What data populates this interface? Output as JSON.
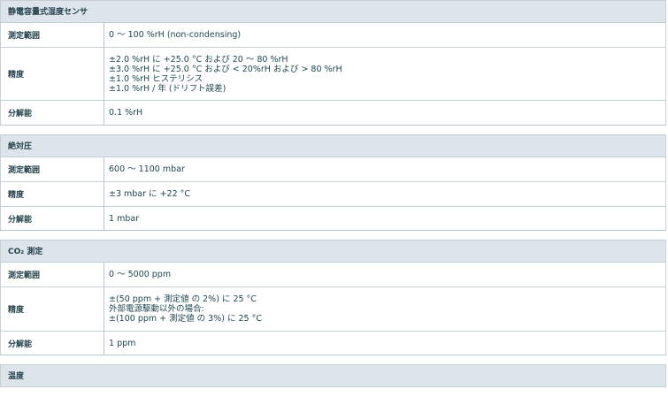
{
  "sections": [
    {
      "title": "静電容量式湿度センサ",
      "rows": [
        {
          "label": "測定範囲",
          "lines": [
            "0 〜 100 %rH (non-condensing)"
          ]
        },
        {
          "label": "精度",
          "lines": [
            "±2.0 %rH に +25.0 °C および 20 〜 80 %rH",
            "±3.0 %rH に +25.0 °C および < 20%rH および > 80 %rH",
            "±1.0 %rH ヒステリシス",
            "±1.0 %rH / 年 (ドリフト誤差)"
          ]
        },
        {
          "label": "分解能",
          "lines": [
            "0.1 %rH"
          ]
        }
      ]
    },
    {
      "title": "絶対圧",
      "rows": [
        {
          "label": "測定範囲",
          "lines": [
            "600 〜 1100 mbar"
          ]
        },
        {
          "label": "精度",
          "lines": [
            "±3 mbar に +22 °C"
          ]
        },
        {
          "label": "分解能",
          "lines": [
            "1 mbar"
          ]
        }
      ]
    },
    {
      "title": "CO₂ 測定",
      "rows": [
        {
          "label": "測定範囲",
          "lines": [
            "0 〜 5000 ppm"
          ]
        },
        {
          "label": "精度",
          "lines": [
            "±(50 ppm + 測定値 の 2%) に 25 °C",
            "外部電源駆動以外の場合:",
            "±(100 ppm + 測定値 の 3%) に 25 °C"
          ]
        },
        {
          "label": "分解能",
          "lines": [
            "1 ppm"
          ]
        }
      ]
    },
    {
      "title": "温度",
      "rows": []
    }
  ]
}
